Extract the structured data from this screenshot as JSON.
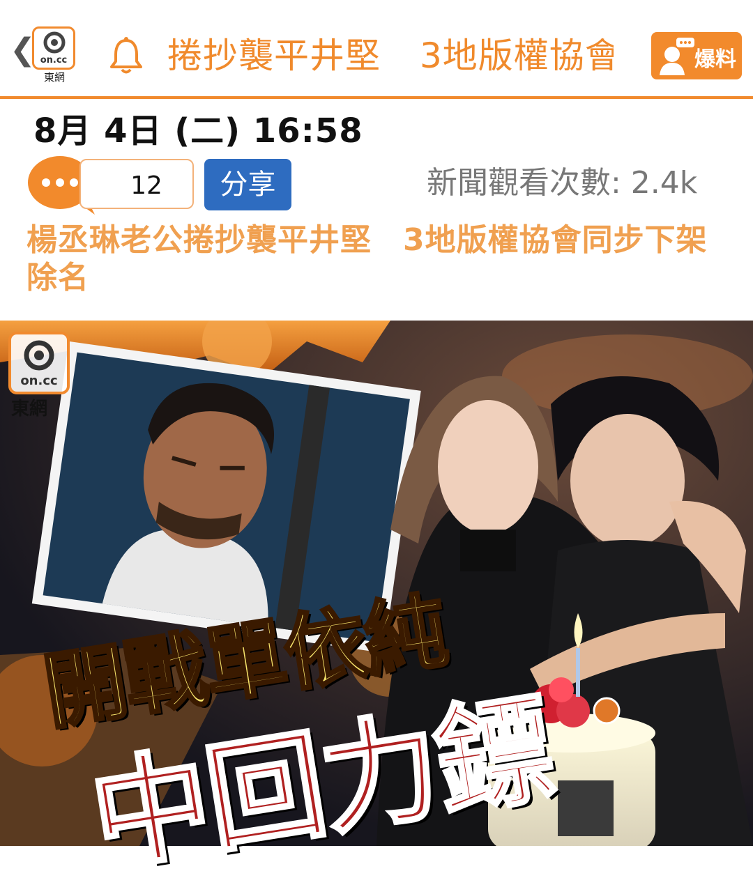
{
  "topbar": {
    "back_icon": "chevron-left-icon",
    "logo_text": "on.cc",
    "logo_caption": "東網",
    "ticker_items": [
      "捲抄襲平井堅",
      "3地版權協會"
    ],
    "report_label": "爆料",
    "accent": "#f18a2e"
  },
  "meta": {
    "date": "8月 4日 (二) 16:58",
    "comment_count": "12",
    "share_label": "分享",
    "views": "新聞觀看次數: 2.4k",
    "share_color": "#2e6cc0"
  },
  "article": {
    "headline": "楊丞琳老公捲抄襲平井堅　3地版權協會同步下架除名"
  },
  "banner": {
    "watermark_text": "on.cc",
    "watermark_caption": "東網",
    "title_line1": "開戰單依純",
    "title_line2": "中回力鏢"
  }
}
